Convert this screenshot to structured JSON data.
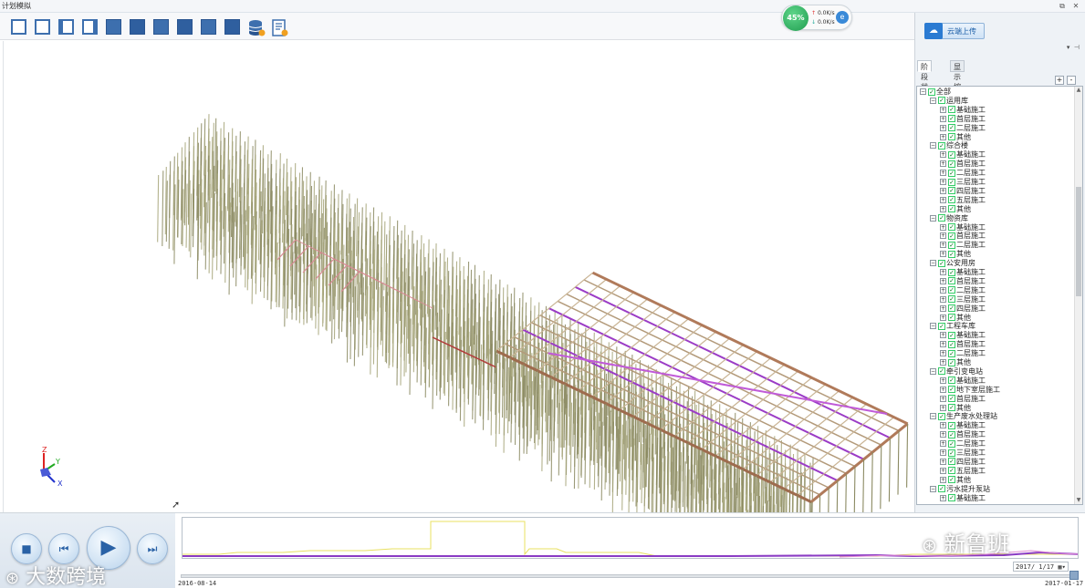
{
  "window": {
    "title": "计划模拟"
  },
  "toolbar": {
    "buttons": [
      "view-front",
      "view-back",
      "view-left",
      "view-right",
      "view-top",
      "view-bottom",
      "view-iso-1",
      "view-iso-2",
      "view-iso-3",
      "view-iso-4",
      "database",
      "report"
    ]
  },
  "network": {
    "percent": "45%",
    "up": "0.0K/s",
    "down": "0.0K/s"
  },
  "right_panel": {
    "cloud_button": "云端上传",
    "tabs": [
      "阶段状态",
      "显示控制"
    ],
    "tree": [
      {
        "level": 0,
        "label": "全部"
      },
      {
        "level": 1,
        "label": "运用库"
      },
      {
        "level": 2,
        "label": "基础施工"
      },
      {
        "level": 2,
        "label": "首层施工"
      },
      {
        "level": 2,
        "label": "二层施工"
      },
      {
        "level": 2,
        "label": "其他"
      },
      {
        "level": 1,
        "label": "综合楼"
      },
      {
        "level": 2,
        "label": "基础施工"
      },
      {
        "level": 2,
        "label": "首层施工"
      },
      {
        "level": 2,
        "label": "二层施工"
      },
      {
        "level": 2,
        "label": "三层施工"
      },
      {
        "level": 2,
        "label": "四层施工"
      },
      {
        "level": 2,
        "label": "五层施工"
      },
      {
        "level": 2,
        "label": "其他"
      },
      {
        "level": 1,
        "label": "物资库"
      },
      {
        "level": 2,
        "label": "基础施工"
      },
      {
        "level": 2,
        "label": "首层施工"
      },
      {
        "level": 2,
        "label": "二层施工"
      },
      {
        "level": 2,
        "label": "其他"
      },
      {
        "level": 1,
        "label": "公安用房"
      },
      {
        "level": 2,
        "label": "基础施工"
      },
      {
        "level": 2,
        "label": "首层施工"
      },
      {
        "level": 2,
        "label": "二层施工"
      },
      {
        "level": 2,
        "label": "三层施工"
      },
      {
        "level": 2,
        "label": "四层施工"
      },
      {
        "level": 2,
        "label": "其他"
      },
      {
        "level": 1,
        "label": "工程车库"
      },
      {
        "level": 2,
        "label": "基础施工"
      },
      {
        "level": 2,
        "label": "首层施工"
      },
      {
        "level": 2,
        "label": "二层施工"
      },
      {
        "level": 2,
        "label": "其他"
      },
      {
        "level": 1,
        "label": "牵引变电站"
      },
      {
        "level": 2,
        "label": "基础施工"
      },
      {
        "level": 2,
        "label": "地下室层施工"
      },
      {
        "level": 2,
        "label": "首层施工"
      },
      {
        "level": 2,
        "label": "其他"
      },
      {
        "level": 1,
        "label": "生产废水处理站"
      },
      {
        "level": 2,
        "label": "基础施工"
      },
      {
        "level": 2,
        "label": "首层施工"
      },
      {
        "level": 2,
        "label": "二层施工"
      },
      {
        "level": 2,
        "label": "三层施工"
      },
      {
        "level": 2,
        "label": "四层施工"
      },
      {
        "level": 2,
        "label": "五层施工"
      },
      {
        "level": 2,
        "label": "其他"
      },
      {
        "level": 1,
        "label": "污水提升泵站"
      },
      {
        "level": 2,
        "label": "基础施工"
      }
    ]
  },
  "axis": {
    "z": "Z",
    "y": "Y",
    "x": "X"
  },
  "playback": {
    "buttons": [
      "stop",
      "rewind",
      "play",
      "forward"
    ]
  },
  "timeline": {
    "start_date": "2016-08-14",
    "end_date": "2017-01-17",
    "current_date": "2017/ 1/17"
  },
  "watermarks": {
    "left": "大数跨境",
    "right": "新鲁班"
  }
}
